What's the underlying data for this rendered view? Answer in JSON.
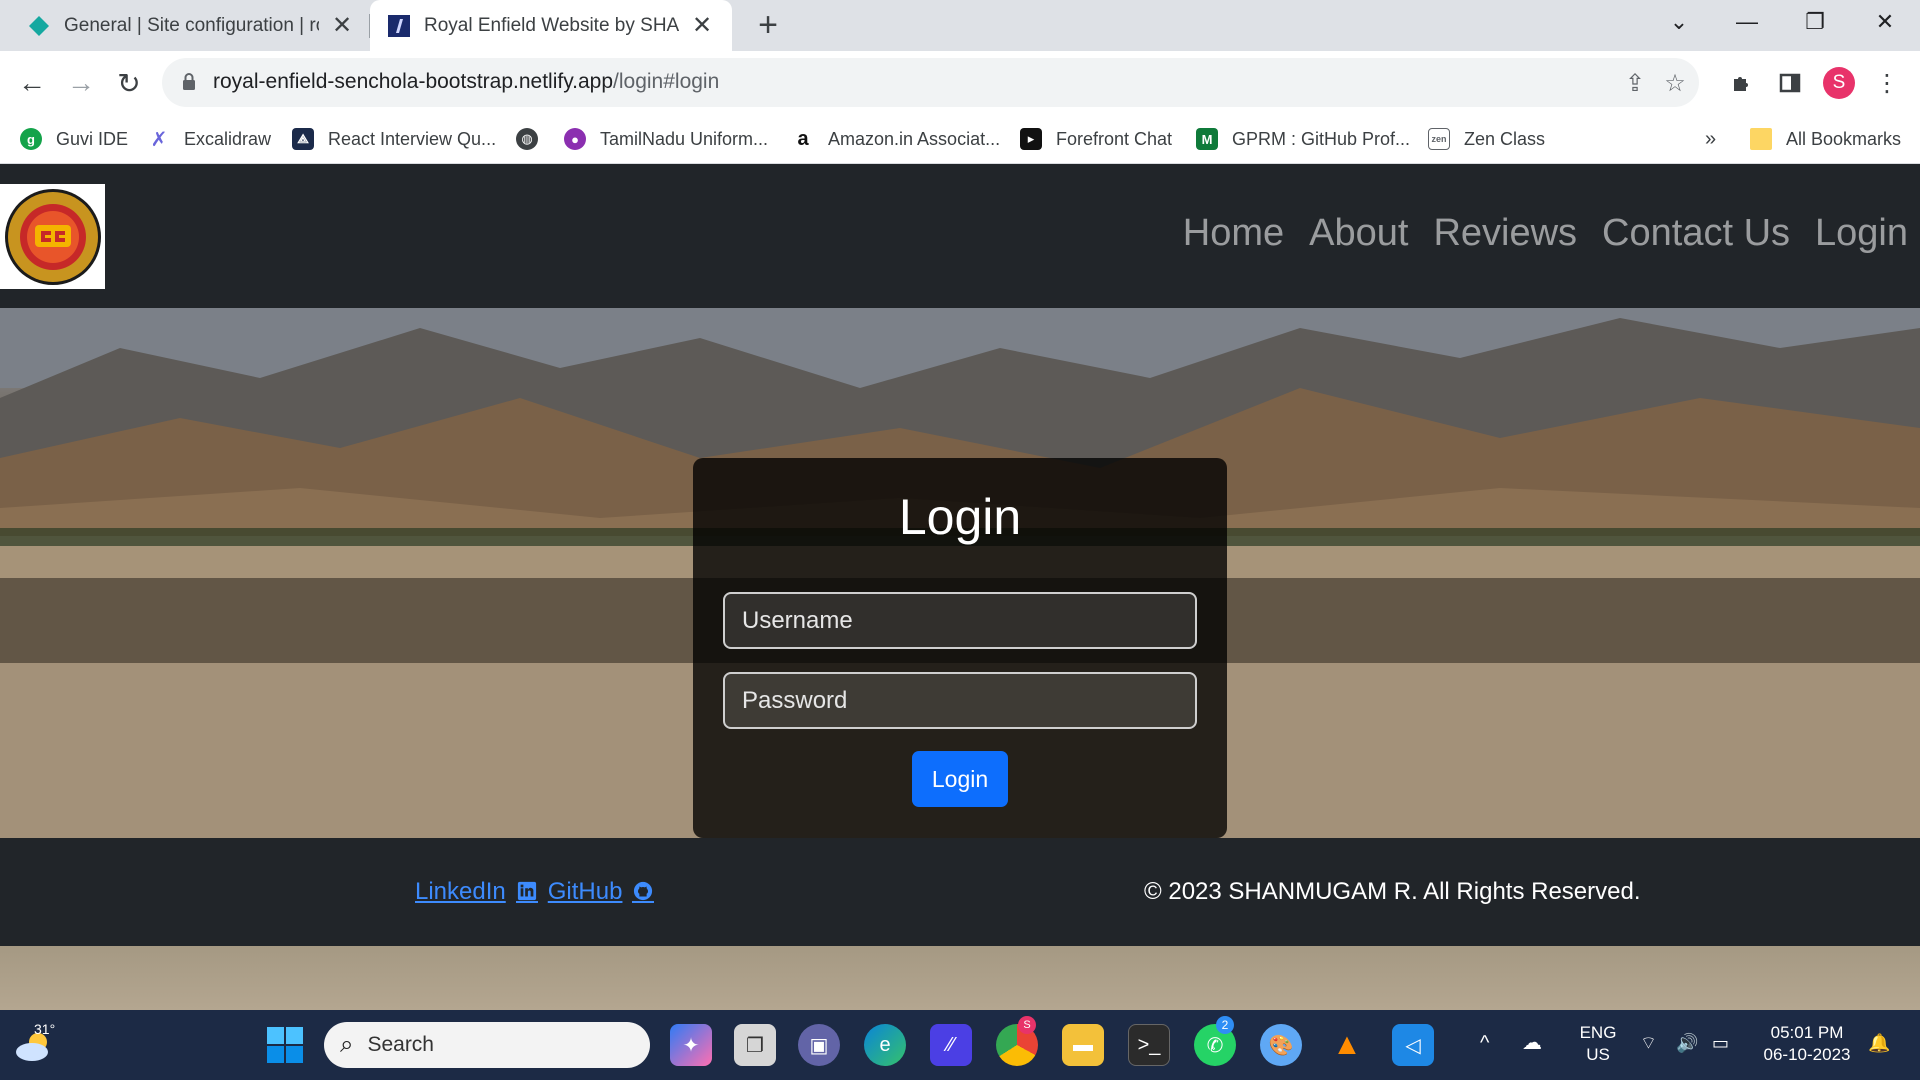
{
  "browser": {
    "tabs": [
      {
        "title": "General | Site configuration | roy",
        "active": false,
        "favicon": "netlify-diamond-icon"
      },
      {
        "title": "Royal Enfield Website by SHANMUGAM",
        "active": true,
        "favicon": "royal-enfield-icon"
      }
    ],
    "url_host": "royal-enfield-senchola-bootstrap.netlify.app",
    "url_path": "/login#login",
    "bookmarks": [
      {
        "label": "Guvi IDE",
        "icon": "guvi-icon",
        "color": "#14a34a"
      },
      {
        "label": "Excalidraw",
        "icon": "excalidraw-icon",
        "color": "#6965db"
      },
      {
        "label": "React Interview Qu...",
        "icon": "react-icon",
        "color": "#1b2a4a"
      },
      {
        "label": "",
        "icon": "globe-icon",
        "color": "#3c4043"
      },
      {
        "label": "TamilNadu Uniform...",
        "icon": "tn-icon",
        "color": "#8b2fb0"
      },
      {
        "label": "Amazon.in Associat...",
        "icon": "amazon-icon",
        "color": "#111111"
      },
      {
        "label": "Forefront Chat",
        "icon": "forefront-icon",
        "color": "#111111"
      },
      {
        "label": "GPRM : GitHub Prof...",
        "icon": "gprm-icon",
        "color": "#0f7a3a"
      },
      {
        "label": "Zen Class",
        "icon": "zen-icon",
        "color": "#5f6368"
      }
    ],
    "more_bookmarks": "»",
    "all_bookmarks": "All Bookmarks",
    "profile_initial": "S"
  },
  "site": {
    "nav": [
      "Home",
      "About",
      "Reviews",
      "Contact Us",
      "Login"
    ],
    "login": {
      "title": "Login",
      "username_placeholder": "Username",
      "password_placeholder": "Password",
      "button": "Login"
    },
    "footer": {
      "linkedin": "LinkedIn",
      "github": "GitHub",
      "copyright": "© 2023 SHANMUGAM R. All Rights Reserved."
    }
  },
  "taskbar": {
    "temperature": "31°",
    "search_placeholder": "Search",
    "language": "ENG",
    "region": "US",
    "time": "05:01 PM",
    "date": "06-10-2023",
    "whatsapp_badge": "2",
    "chrome_badge": "S"
  },
  "colors": {
    "navbar": "#212529",
    "primary": "#0d6efd",
    "link": "#3d8bfd"
  }
}
